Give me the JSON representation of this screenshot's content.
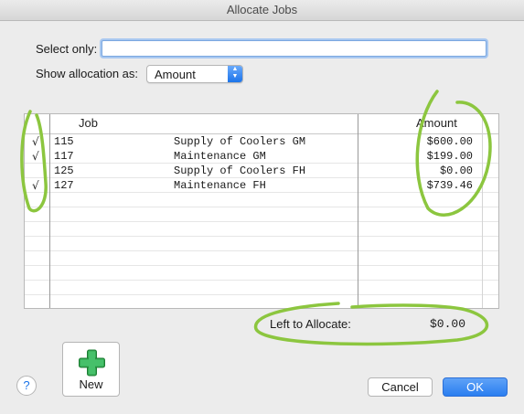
{
  "window": {
    "title": "Allocate Jobs"
  },
  "filter": {
    "select_only_label": "Select only:",
    "select_only_value": "",
    "show_label": "Show allocation as:",
    "show_value": "Amount"
  },
  "table": {
    "headers": {
      "job": "Job",
      "amount": "Amount"
    },
    "rows": [
      {
        "checked": "√",
        "job": "115",
        "desc": "Supply of Coolers GM",
        "amount": "$600.00"
      },
      {
        "checked": "√",
        "job": "117",
        "desc": "Maintenance GM",
        "amount": "$199.00"
      },
      {
        "checked": "",
        "job": "125",
        "desc": "Supply of Coolers FH",
        "amount": "$0.00"
      },
      {
        "checked": "√",
        "job": "127",
        "desc": "Maintenance FH",
        "amount": "$739.46"
      }
    ]
  },
  "summary": {
    "left_label": "Left to Allocate:",
    "left_value": "$0.00"
  },
  "buttons": {
    "help": "?",
    "new": "New",
    "cancel": "Cancel",
    "ok": "OK"
  },
  "colors": {
    "accent": "#2a7ef0",
    "highlight": "#8cc63f",
    "plus": "#34a853"
  }
}
